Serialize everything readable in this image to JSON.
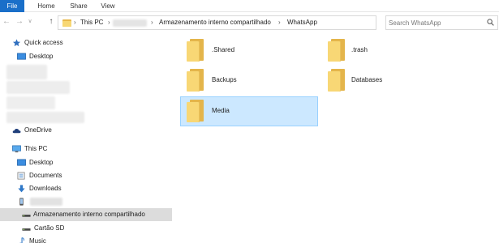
{
  "ribbon": {
    "tabs": [
      "File",
      "Home",
      "Share",
      "View"
    ]
  },
  "navigation": {
    "back_icon": "back-arrow-icon",
    "forward_icon": "forward-arrow-icon",
    "up_icon": "up-arrow-icon",
    "path": [
      {
        "label": "This PC"
      },
      {
        "label": ""
      },
      {
        "label": "Armazenamento interno compartilhado"
      },
      {
        "label": "WhatsApp"
      }
    ],
    "separator": "›",
    "search_placeholder": "Search WhatsApp"
  },
  "sidebar": {
    "quick_access": "Quick access",
    "desktop": "Desktop",
    "onedrive": "OneDrive",
    "this_pc": "This PC",
    "this_pc_children": {
      "desktop": "Desktop",
      "documents": "Documents",
      "downloads": "Downloads",
      "internal_storage": "Armazenamento interno compartilhado",
      "sd_card": "Cartão SD",
      "music": "Music"
    }
  },
  "folders": [
    {
      "name": ".Shared",
      "selected": false
    },
    {
      "name": ".trash",
      "selected": false
    },
    {
      "name": "Backups",
      "selected": false
    },
    {
      "name": "Databases",
      "selected": false
    },
    {
      "name": "Media",
      "selected": true
    }
  ],
  "colors": {
    "file_tab": "#1a6fc9",
    "selection_fill": "#cce8ff",
    "selection_border": "#99d1ff",
    "sidebar_selected": "#dcdcdc",
    "folder_yellow": "#f8d775"
  }
}
